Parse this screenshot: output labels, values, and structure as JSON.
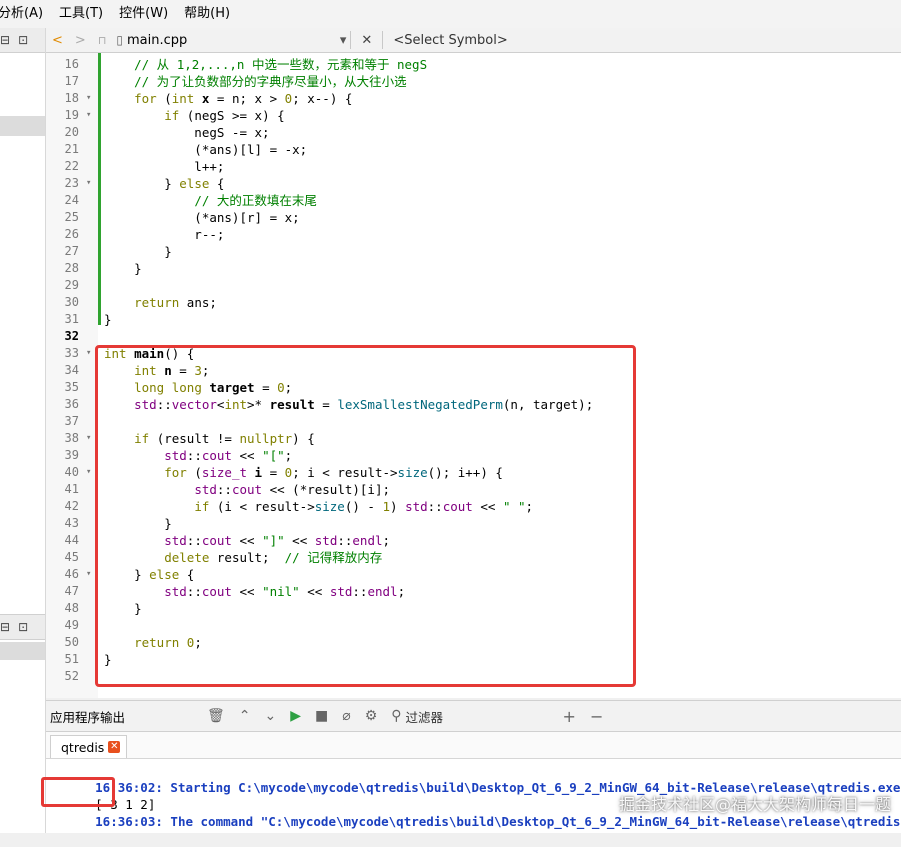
{
  "menu": [
    "分析(A)",
    "工具(T)",
    "控件(W)",
    "帮助(H)"
  ],
  "left_toolbar_icons": [
    "split-icon",
    "collapse-icon"
  ],
  "editor_toolbar": {
    "back": "<",
    "forward": ">",
    "lock": "🔒",
    "file_name": "main.cpp",
    "dropdown": "▾",
    "close": "✕",
    "symbol": "<Select Symbol>"
  },
  "code_lines": [
    {
      "n": "16",
      "fold": "",
      "html": "    <span class=\"cm\">// 从 1,2,...,n 中选一些数，元素和等于 negS</span>"
    },
    {
      "n": "17",
      "fold": "",
      "html": "    <span class=\"cm\">// 为了让负数部分的字典序尽量小，从大往小选</span>"
    },
    {
      "n": "18",
      "fold": "▾",
      "html": "    <span class=\"kw\">for</span> (<span class=\"kw\">int</span> <span class=\"bd\">x</span> = n; x &gt; <span class=\"kw\">0</span>; x--) {"
    },
    {
      "n": "19",
      "fold": "▾",
      "html": "        <span class=\"kw\">if</span> (negS &gt;= x) {"
    },
    {
      "n": "20",
      "fold": "",
      "html": "            negS -= x;"
    },
    {
      "n": "21",
      "fold": "",
      "html": "            (*ans)[l] = -x;"
    },
    {
      "n": "22",
      "fold": "",
      "html": "            l++;"
    },
    {
      "n": "23",
      "fold": "▾",
      "html": "        } <span class=\"kw\">else</span> {"
    },
    {
      "n": "24",
      "fold": "",
      "html": "            <span class=\"cm\">// 大的正数填在末尾</span>"
    },
    {
      "n": "25",
      "fold": "",
      "html": "            (*ans)[r] = x;"
    },
    {
      "n": "26",
      "fold": "",
      "html": "            r--;"
    },
    {
      "n": "27",
      "fold": "",
      "html": "        }"
    },
    {
      "n": "28",
      "fold": "",
      "html": "    }"
    },
    {
      "n": "29",
      "fold": "",
      "html": ""
    },
    {
      "n": "30",
      "fold": "",
      "html": "    <span class=\"kw\">return</span> ans;"
    },
    {
      "n": "31",
      "fold": "",
      "html": "}"
    },
    {
      "n": "32",
      "fold": "",
      "html": ""
    },
    {
      "n": "33",
      "fold": "▾",
      "html": "<span class=\"kw\">int</span> <span class=\"bd\">main</span>() {"
    },
    {
      "n": "34",
      "fold": "",
      "html": "    <span class=\"kw\">int</span> <span class=\"bd\">n</span> = <span class=\"kw\">3</span>;"
    },
    {
      "n": "35",
      "fold": "",
      "html": "    <span class=\"kw\">long</span> <span class=\"kw\">long</span> <span class=\"bd\">target</span> = <span class=\"kw\">0</span>;"
    },
    {
      "n": "36",
      "fold": "",
      "html": "    <span class=\"ns\">std</span>::<span class=\"ty\">vector</span>&lt;<span class=\"kw\">int</span>&gt;* <span class=\"bd\">result</span> = <span class=\"fn\">lexSmallestNegatedPerm</span>(n, target);"
    },
    {
      "n": "37",
      "fold": "",
      "html": ""
    },
    {
      "n": "38",
      "fold": "▾",
      "html": "    <span class=\"kw\">if</span> (result != <span class=\"kw\">nullptr</span>) {"
    },
    {
      "n": "39",
      "fold": "",
      "html": "        <span class=\"ns\">std</span>::<span class=\"ty\">cout</span> &lt;&lt; <span class=\"st\">\"[\"</span>;"
    },
    {
      "n": "40",
      "fold": "▾",
      "html": "        <span class=\"kw\">for</span> (<span class=\"ty\">size_t</span> <span class=\"bd\">i</span> = <span class=\"kw\">0</span>; i &lt; result-&gt;<span class=\"fn\">size</span>(); i++) {"
    },
    {
      "n": "41",
      "fold": "",
      "html": "            <span class=\"ns\">std</span>::<span class=\"ty\">cout</span> &lt;&lt; (*result)[i];"
    },
    {
      "n": "42",
      "fold": "",
      "html": "            <span class=\"kw\">if</span> (i &lt; result-&gt;<span class=\"fn\">size</span>() - <span class=\"kw\">1</span>) <span class=\"ns\">std</span>::<span class=\"ty\">cout</span> &lt;&lt; <span class=\"st\">\" \"</span>;"
    },
    {
      "n": "43",
      "fold": "",
      "html": "        }"
    },
    {
      "n": "44",
      "fold": "",
      "html": "        <span class=\"ns\">std</span>::<span class=\"ty\">cout</span> &lt;&lt; <span class=\"st\">\"]\"</span> &lt;&lt; <span class=\"ns\">std</span>::<span class=\"ty\">endl</span>;"
    },
    {
      "n": "45",
      "fold": "",
      "html": "        <span class=\"kw\">delete</span> result;  <span class=\"cm\">// 记得释放内存</span>"
    },
    {
      "n": "46",
      "fold": "▾",
      "html": "    } <span class=\"kw\">else</span> {"
    },
    {
      "n": "47",
      "fold": "",
      "html": "        <span class=\"ns\">std</span>::<span class=\"ty\">cout</span> &lt;&lt; <span class=\"st\">\"nil\"</span> &lt;&lt; <span class=\"ns\">std</span>::<span class=\"ty\">endl</span>;"
    },
    {
      "n": "48",
      "fold": "",
      "html": "    }"
    },
    {
      "n": "49",
      "fold": "",
      "html": ""
    },
    {
      "n": "50",
      "fold": "",
      "html": "    <span class=\"kw\">return</span> <span class=\"kw\">0</span>;"
    },
    {
      "n": "51",
      "fold": "",
      "html": "}"
    },
    {
      "n": "52",
      "fold": "",
      "html": ""
    }
  ],
  "current_line": "32",
  "output_panel": {
    "title": "应用程序输出",
    "filter_label": "过滤器",
    "plus": "+",
    "minus": "−",
    "tab_label": "qtredis",
    "tab_close": "✕",
    "lines": [
      {
        "time": "16:36:02:",
        "text": " Starting C:\\mycode\\mycode\\qtredis\\build\\Desktop_Qt_6_9_2_MinGW_64_bit-Release\\release\\qtredis.exe..."
      },
      {
        "time": "",
        "text": "[-3 1 2]"
      },
      {
        "time": "16:36:03:",
        "text": " The command \"C:\\mycode\\mycode\\qtredis\\build\\Desktop_Qt_6_9_2_MinGW_64_bit-Release\\release\\qtredis.exe\""
      }
    ]
  },
  "watermark": "掘金技术社区@福大大架构师每日一题"
}
